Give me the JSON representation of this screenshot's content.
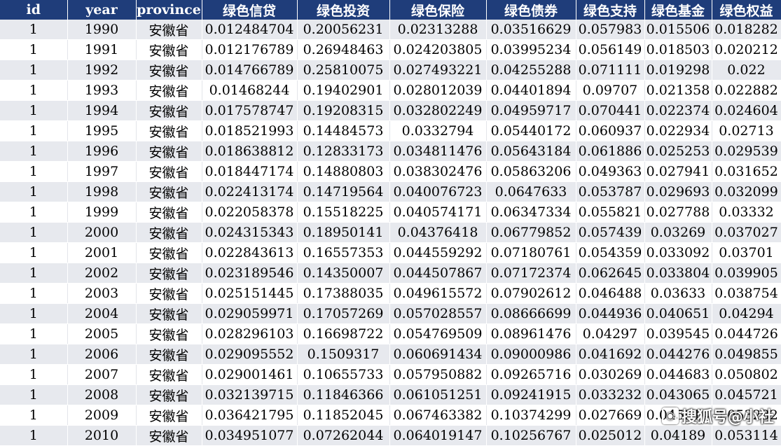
{
  "table": {
    "headers": [
      "id",
      "year",
      "province",
      "绿色信贷",
      "绿色投资",
      "绿色保险",
      "绿色债券",
      "绿色支持",
      "绿色基金",
      "绿色权益"
    ],
    "rows": [
      [
        "1",
        "1990",
        "安徽省",
        "0.012484704",
        "0.20056231",
        "0.02313288",
        "0.03516629",
        "0.057983",
        "0.015506",
        "0.018282"
      ],
      [
        "1",
        "1991",
        "安徽省",
        "0.012176789",
        "0.26948463",
        "0.024203805",
        "0.03995234",
        "0.056149",
        "0.018503",
        "0.020212"
      ],
      [
        "1",
        "1992",
        "安徽省",
        "0.014766789",
        "0.25810075",
        "0.027493221",
        "0.04255288",
        "0.071111",
        "0.019298",
        "0.022"
      ],
      [
        "1",
        "1993",
        "安徽省",
        "0.01468244",
        "0.19402901",
        "0.028012039",
        "0.04401894",
        "0.09707",
        "0.021358",
        "0.022882"
      ],
      [
        "1",
        "1994",
        "安徽省",
        "0.017578747",
        "0.19208315",
        "0.032802249",
        "0.04959717",
        "0.070441",
        "0.022374",
        "0.024604"
      ],
      [
        "1",
        "1995",
        "安徽省",
        "0.018521993",
        "0.14484573",
        "0.0332794",
        "0.05440172",
        "0.060937",
        "0.022934",
        "0.02713"
      ],
      [
        "1",
        "1996",
        "安徽省",
        "0.018638812",
        "0.12833173",
        "0.034811476",
        "0.05643184",
        "0.061886",
        "0.025253",
        "0.029539"
      ],
      [
        "1",
        "1997",
        "安徽省",
        "0.018447174",
        "0.14880803",
        "0.038302476",
        "0.05863206",
        "0.049363",
        "0.027941",
        "0.031652"
      ],
      [
        "1",
        "1998",
        "安徽省",
        "0.022413174",
        "0.14719564",
        "0.040076723",
        "0.0647633",
        "0.053787",
        "0.029693",
        "0.032099"
      ],
      [
        "1",
        "1999",
        "安徽省",
        "0.022058378",
        "0.15518225",
        "0.040574171",
        "0.06347334",
        "0.055821",
        "0.027788",
        "0.03332"
      ],
      [
        "1",
        "2000",
        "安徽省",
        "0.024315343",
        "0.18950141",
        "0.04376418",
        "0.06779852",
        "0.057439",
        "0.03269",
        "0.037027"
      ],
      [
        "1",
        "2001",
        "安徽省",
        "0.022843613",
        "0.16557353",
        "0.044559292",
        "0.07180761",
        "0.054359",
        "0.033092",
        "0.03701"
      ],
      [
        "1",
        "2002",
        "安徽省",
        "0.023189546",
        "0.14350007",
        "0.044507867",
        "0.07172374",
        "0.062645",
        "0.033804",
        "0.039905"
      ],
      [
        "1",
        "2003",
        "安徽省",
        "0.025151445",
        "0.17388035",
        "0.049615572",
        "0.07902612",
        "0.046488",
        "0.03633",
        "0.038754"
      ],
      [
        "1",
        "2004",
        "安徽省",
        "0.029059971",
        "0.17057269",
        "0.057028557",
        "0.08666699",
        "0.044936",
        "0.040651",
        "0.04294"
      ],
      [
        "1",
        "2005",
        "安徽省",
        "0.028296103",
        "0.16698722",
        "0.054769509",
        "0.08961476",
        "0.04297",
        "0.039545",
        "0.044726"
      ],
      [
        "1",
        "2006",
        "安徽省",
        "0.029095552",
        "0.1509317",
        "0.060691434",
        "0.09000986",
        "0.041692",
        "0.044276",
        "0.049855"
      ],
      [
        "1",
        "2007",
        "安徽省",
        "0.029001461",
        "0.10655733",
        "0.057950882",
        "0.09265716",
        "0.030269",
        "0.044683",
        "0.050802"
      ],
      [
        "1",
        "2008",
        "安徽省",
        "0.032139715",
        "0.11846366",
        "0.061051251",
        "0.09241915",
        "0.033232",
        "0.043065",
        "0.045721"
      ],
      [
        "1",
        "2009",
        "安徽省",
        "0.036421795",
        "0.11852045",
        "0.067463382",
        "0.10374299",
        "0.027669",
        "0.045914",
        "0.053232"
      ],
      [
        "1",
        "2010",
        "安徽省",
        "0.034951077",
        "0.07262044",
        "0.064019147",
        "0.10256767",
        "0.025012",
        "0.04189",
        "0.053114"
      ]
    ]
  },
  "watermark": {
    "text": "搜狐号@小社",
    "icon": "sohu-logo-icon"
  }
}
